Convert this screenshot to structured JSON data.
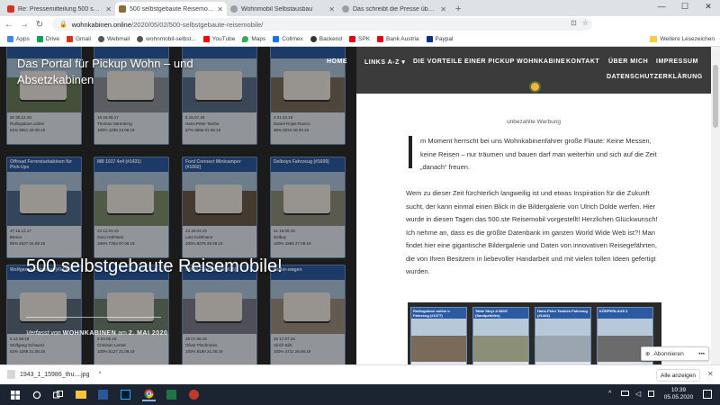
{
  "browser": {
    "tabs": [
      {
        "label": "Re: Pressemitteilung 500 selbstg...",
        "active": false,
        "favicon_color": "#d93025"
      },
      {
        "label": "500 selbstgebaute Reisemobile!",
        "active": true,
        "favicon_color": "#8a6d3b"
      },
      {
        "label": "Wohnmobil Selbstausbau",
        "active": false,
        "favicon_color": "#5f6368"
      },
      {
        "label": "Das schreibt die Presse über uns",
        "active": false,
        "favicon_color": "#5f6368"
      }
    ],
    "url_host": "wohnkabinen.online",
    "url_path": "/2020/05/02/500-selbstgebaute-reisemobile/",
    "bookmarks": [
      {
        "label": "Apps",
        "color": "#4285f4"
      },
      {
        "label": "Drive",
        "color": "#0f9d58"
      },
      {
        "label": "Gmail",
        "color": "#d93025"
      },
      {
        "label": "Webmail",
        "color": "#555555"
      },
      {
        "label": "wohnmobil-selbst...",
        "color": "#555555"
      },
      {
        "label": "YouTube",
        "color": "#ff0000"
      },
      {
        "label": "Maps",
        "color": "#34a853"
      },
      {
        "label": "Collmex",
        "color": "#1a73e8"
      },
      {
        "label": "Backend",
        "color": "#333333"
      },
      {
        "label": "SPK",
        "color": "#e30613"
      },
      {
        "label": "Bank Austria",
        "color": "#e30613"
      },
      {
        "label": "Paypal",
        "color": "#003087"
      }
    ],
    "other_bookmarks": "Weitere Lesezeichen"
  },
  "site": {
    "title": "Das Portal für Pickup Wohn – und Absetzkabinen",
    "nav": [
      "HOME",
      "LINKS A-Z",
      "DIE VORTEILE EINER PICKUP WOHNKABINE",
      "KONTAKT",
      "ÜBER MICH",
      "IMPRESSUM",
      "DATENSCHUTZERKLÄRUNG"
    ],
    "post_title": "500 selbstgebaute Reisemobile!",
    "meta_prefix": "Verfasst von",
    "meta_author": "WOHNKABINEN",
    "meta_mid": "am",
    "meta_date": "2. MAI 2020",
    "ad_label": "unbezahlte Werbung",
    "para1": "m Moment herrscht bei uns Wohnkabinenfahrer große Flaute: Keine Messen, keine Reisen – nur träumen und bauen darf man weiterhin und sich auf die Zeit „danach“ freuen.",
    "para2": "Wem zu dieser Zeit fürchterlich langweilig ist und etwas Inspiration für die Zukunft sucht, der kann einmal einen Blick in die Bildergalerie von Ulrich Dolde werfen. Hier wurde in diesen Tagen das 500.ste Reisemobil vorgestellt! Herzlichen Glückwunsch! Ich nehme an, dass es die größte Datenbank im ganzen World Wide Web ist?! Man findet hier eine gigantische Bildergalerie und Daten von innovativen Reisegefährten, die von Ihren Besitzern in liebevoller Handarbeit und mit vielen tollen Ideen gefertigt wurden.",
    "subscribe": "Abonnieren"
  },
  "gallery_left": [
    {
      "title": "",
      "m1": "20",
      "m2": "30.12.18",
      "m3": "Rollingstone.online",
      "m4": "62%  8661  28.08.19"
    },
    {
      "title": "",
      "m1": "18",
      "m2": "26.09.17",
      "m3": "Thomas Nürenberg",
      "m4": "100%  4239  24.08.19"
    },
    {
      "title": "",
      "m1": "5",
      "m2": "15.07.19",
      "m3": "Hans-Peter Tambe",
      "m4": "67%  8686  01.09.19"
    },
    {
      "title": "",
      "m1": "4",
      "m2": "01.02.18",
      "m3": "Daniel Rojas-Rancic",
      "m4": "86%  8024  28.03.19"
    },
    {
      "title": "Offroad Fernreisekabinen für Pick-Ups",
      "m1": "47",
      "m2": "15.12.17",
      "m3": "Benno",
      "m4": "85%  8427  04.09.19"
    },
    {
      "title": "MB 1017 4x4 (#1431)",
      "m1": "34",
      "m2": "12.03.19",
      "m3": "Gero Hofmann",
      "m4": "100%  7264  07.08.19"
    },
    {
      "title": "Ford Connect Minicamper (#1502)",
      "m1": "44",
      "m2": "15.04.19",
      "m3": "Lars Kuhlmann",
      "m4": "100%  8276  29.08.19"
    },
    {
      "title": "Delboys Fahrzeug (#1609)",
      "m1": "21",
      "m2": "19.08.19",
      "m3": "Delboy",
      "m4": "100%  1868  27.09.19"
    },
    {
      "title": "Wolfgangs Fahrzeug (#1434)",
      "m1": "5",
      "m2": "14.08.19",
      "m3": "Wolfgang Schwanz",
      "m4": "52%  1268  21.09.19"
    },
    {
      "title": "",
      "m1": "5",
      "m2": "03.08.19",
      "m3": "Christian Lerner",
      "m4": "100%  5127  21.09.19"
    },
    {
      "title": "Oliver Fahrzeug (#1625)",
      "m1": "29",
      "m2": "07.08.19",
      "m3": "Oliver Plachmeier",
      "m4": "100%  8180  21.09.19"
    },
    {
      "title": "Boller-wagen",
      "m1": "25",
      "m2": "17.07.19",
      "m3": "Ulrich Birk",
      "m4": "100%  4711  26.09.19"
    }
  ],
  "gallery_right": [
    {
      "title": "Rollingstone online o Fahrzeug (#1377)"
    },
    {
      "title": "Table Steyr A 680G (Sandpebbles)"
    },
    {
      "title": "Hans-Peter Tambes Fahrzeug (#1444)"
    },
    {
      "title": "KÖRPERLAUS 3"
    }
  ],
  "download": {
    "filename": "1943_1_15986_thu....jpg",
    "show_all": "Alle anzeigen"
  },
  "taskbar": {
    "time": "10:39",
    "date": "05.05.2020"
  },
  "colors": {
    "nav_bg": "#3b3b3b",
    "card_title": "#2c5aa0",
    "taskbar": "#1b2430"
  }
}
